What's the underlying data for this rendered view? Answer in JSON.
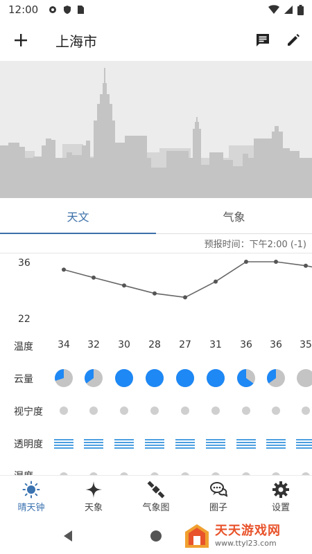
{
  "status_bar": {
    "time": "12:00"
  },
  "app_bar": {
    "city": "上海市"
  },
  "tabs": [
    {
      "label": "天文",
      "active": true
    },
    {
      "label": "气象",
      "active": false
    }
  ],
  "forecast_time": "预报时间：下午2:00 (-1)",
  "accent_color": "#3b6fa8",
  "rows": {
    "temperature": "温度",
    "cloud": "云量",
    "seeing": "视宁度",
    "transparency": "透明度",
    "humidity": "湿度"
  },
  "chart_data": {
    "type": "line",
    "y_axis_labels": [
      "36",
      "22"
    ],
    "ylim": [
      22,
      36
    ],
    "x": [
      1,
      2,
      3,
      4,
      5,
      6,
      7,
      8,
      9
    ],
    "temperature": [
      34,
      32,
      30,
      28,
      27,
      31,
      36,
      36,
      35
    ],
    "temperature_labels": [
      "34",
      "32",
      "30",
      "28",
      "27",
      "31",
      "36",
      "36",
      "35"
    ],
    "cloud_cover": [
      0.3,
      0.35,
      1.0,
      1.0,
      1.0,
      1.0,
      0.65,
      0.35,
      0.0
    ],
    "line_color": "#666666",
    "cloud_color": "#1e88f5"
  },
  "bottom_nav": [
    {
      "label": "晴天钟",
      "icon": "sun-icon",
      "active": true
    },
    {
      "label": "天象",
      "icon": "sparkle-icon",
      "active": false
    },
    {
      "label": "气象图",
      "icon": "satellite-icon",
      "active": false
    },
    {
      "label": "圈子",
      "icon": "chat-bubbles-icon",
      "active": false
    },
    {
      "label": "设置",
      "icon": "gear-icon",
      "active": false
    }
  ],
  "watermark": {
    "main": "天天游戏网",
    "sub": "www.ttyl23.com"
  }
}
